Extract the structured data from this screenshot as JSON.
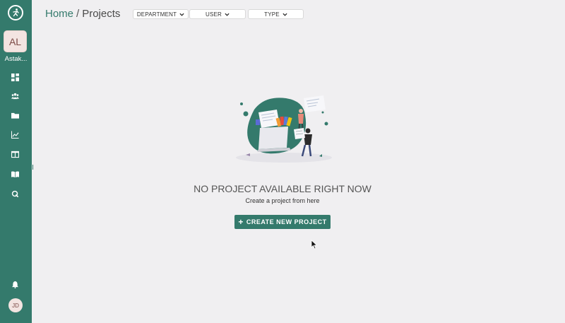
{
  "sidebar": {
    "workspace_initials": "AL",
    "workspace_name": "Astak...",
    "user_initials": "JD",
    "nav_icons": [
      "dashboard-icon",
      "people-icon",
      "folder-icon",
      "chart-icon",
      "table-icon",
      "book-icon",
      "q-icon"
    ]
  },
  "breadcrumb": {
    "home": "Home",
    "separator": "/",
    "current": "Projects"
  },
  "filters": [
    {
      "label": "DEPARTMENT"
    },
    {
      "label": "USER"
    },
    {
      "label": "TYPE"
    }
  ],
  "empty_state": {
    "title": "NO PROJECT AVAILABLE RIGHT NOW",
    "subtitle": "Create a project from here",
    "button_label": "CREATE NEW PROJECT"
  },
  "colors": {
    "accent": "#347a6c",
    "background": "#f0eff1"
  }
}
